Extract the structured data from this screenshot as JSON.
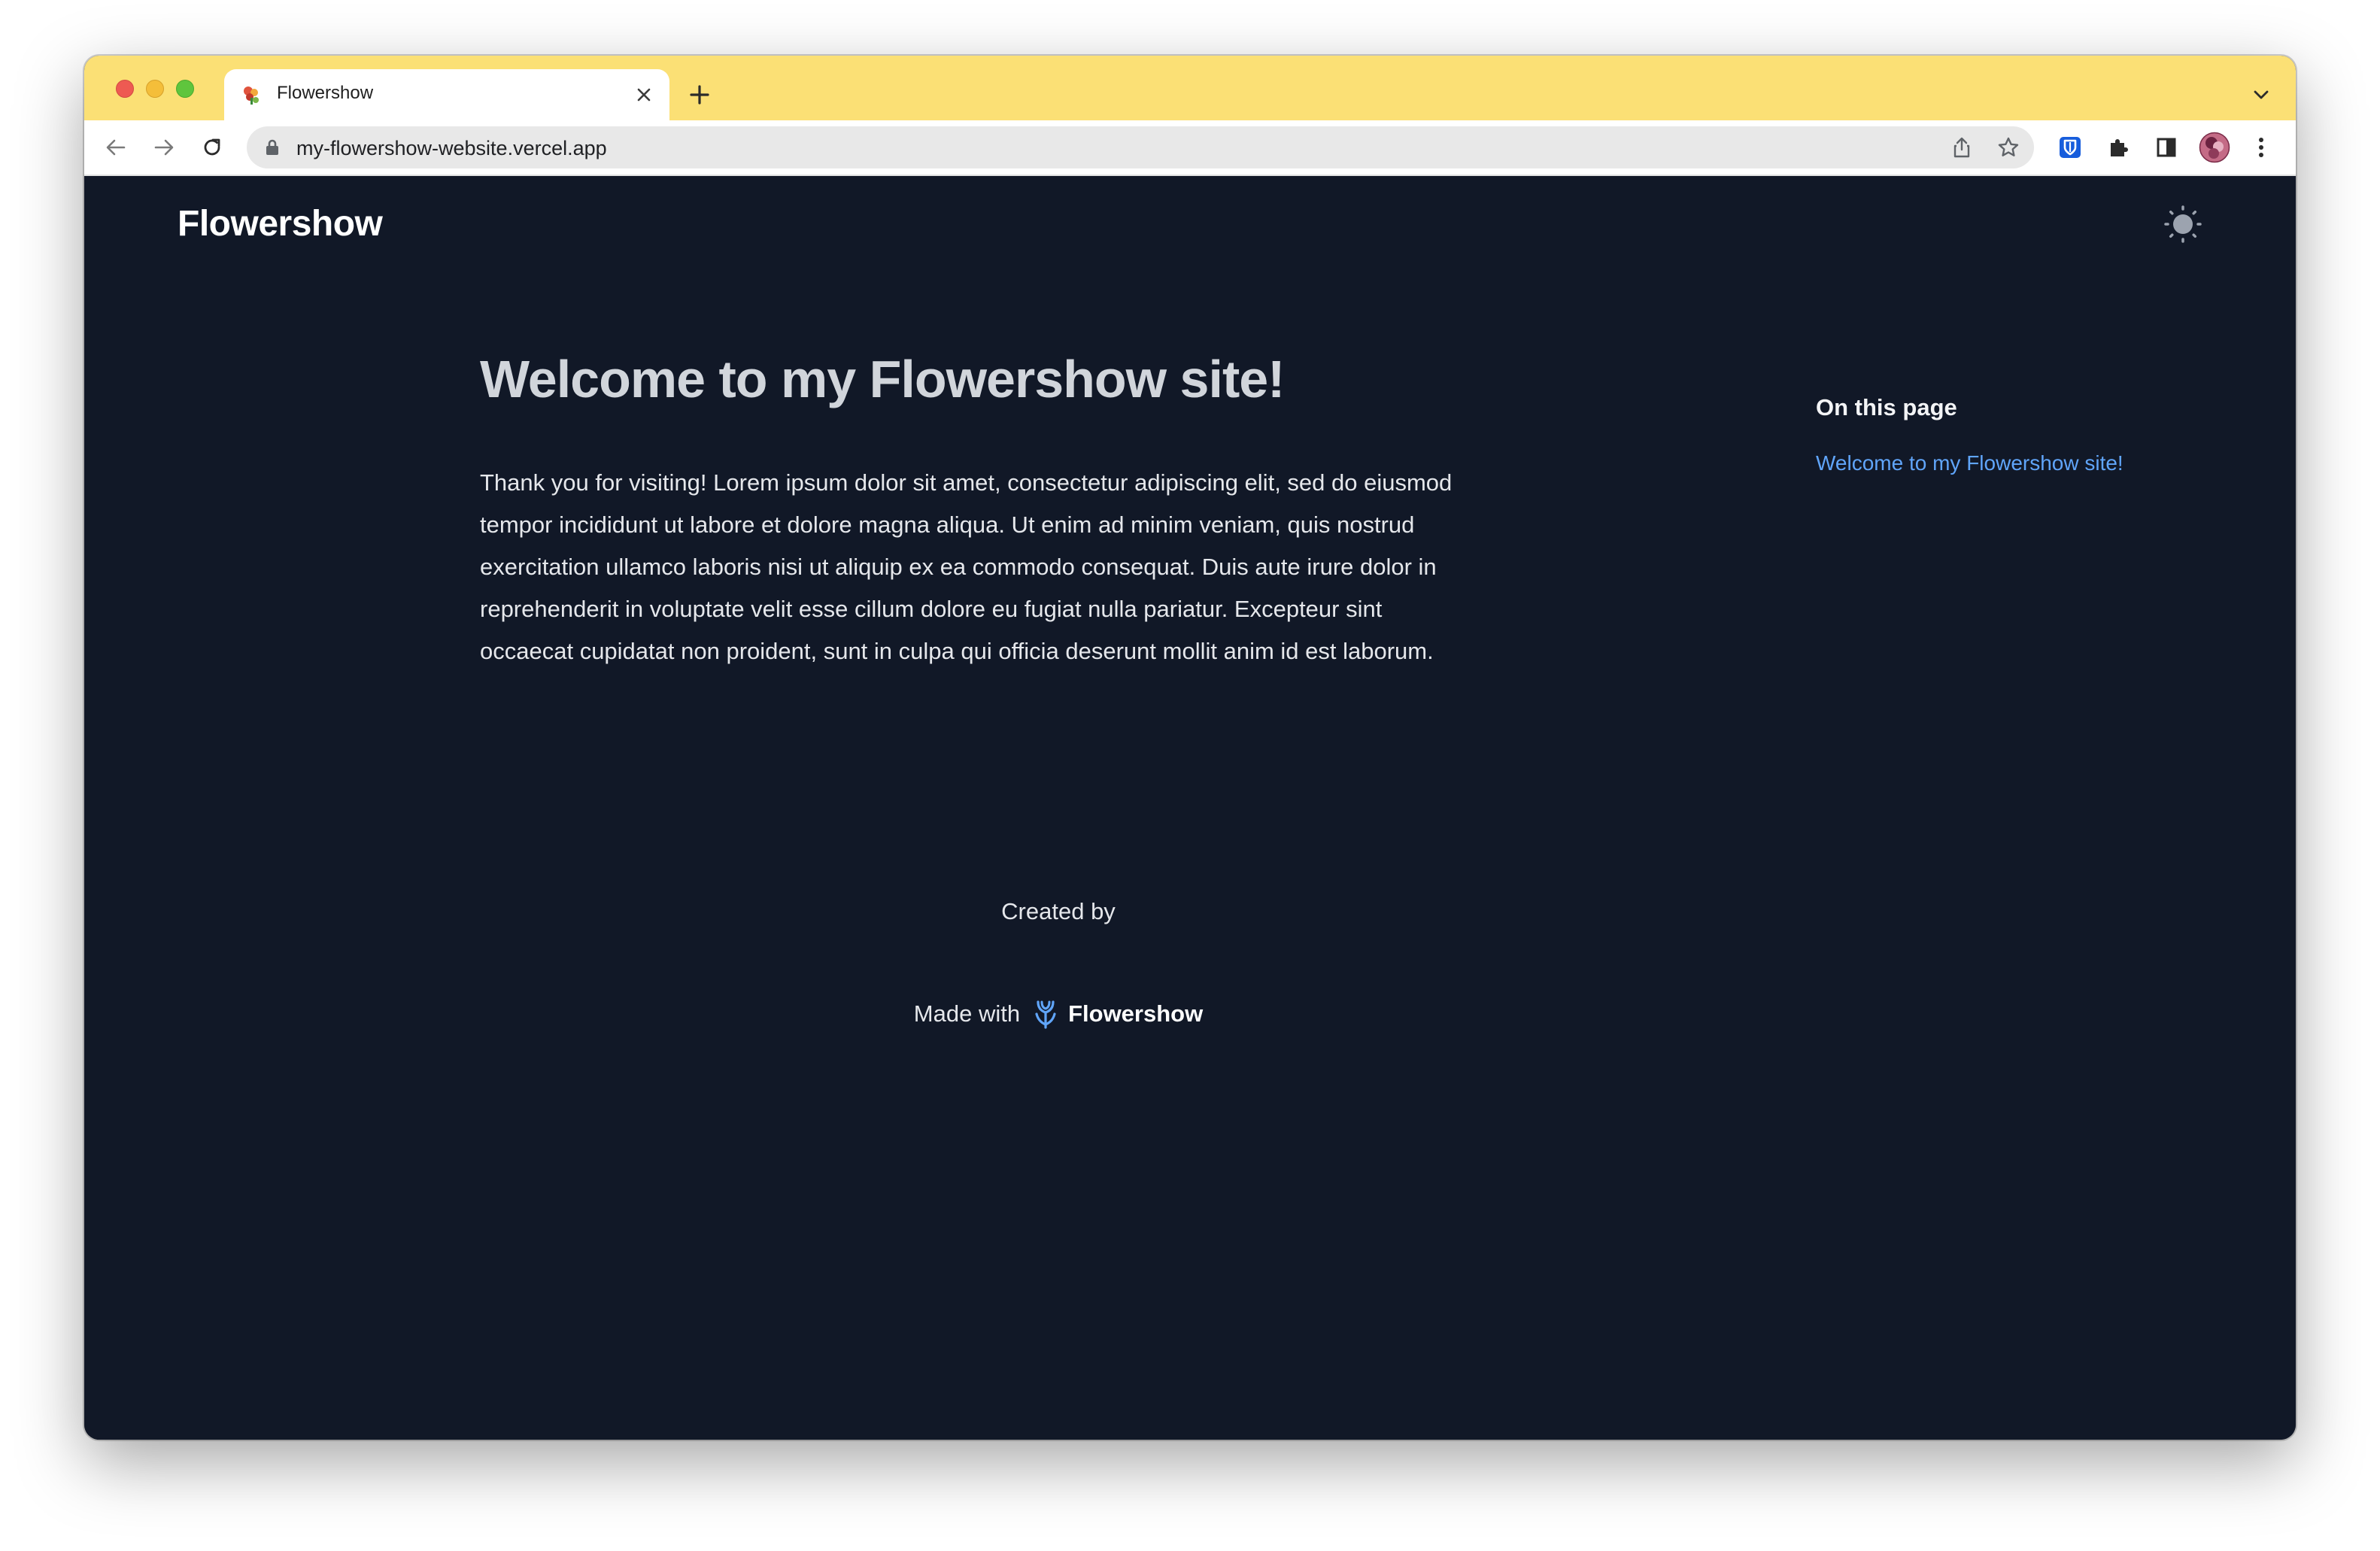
{
  "browser": {
    "tab": {
      "title": "Flowershow"
    },
    "address_bar": {
      "url": "my-flowershow-website.vercel.app"
    }
  },
  "site": {
    "logo": "Flowershow"
  },
  "article": {
    "title": "Welcome to my Flowershow site!",
    "body": "Thank you for visiting! Lorem ipsum dolor sit amet, consectetur adipiscing elit, sed do eiusmod tempor incididunt ut labore et dolore magna aliqua. Ut enim ad minim veniam, quis nostrud exercitation ullamco laboris nisi ut aliquip ex ea commodo consequat. Duis aute irure dolor in reprehenderit in voluptate velit esse cillum dolore eu fugiat nulla pariatur. Excepteur sint occaecat cupidatat non proident, sunt in culpa qui officia deserunt mollit anim id est laborum."
  },
  "toc": {
    "heading": "On this page",
    "items": [
      {
        "label": "Welcome to my Flowershow site!"
      }
    ]
  },
  "footer": {
    "created_by": "Created by",
    "made_with": "Made with",
    "brand": "Flowershow"
  },
  "colors": {
    "tabstrip": "#fbe075",
    "page_background": "#111827",
    "link": "#60a5fa",
    "title": "#d1d5db"
  },
  "icons": {
    "theme_toggle": "sun-icon",
    "brand": "flowershow-logo-icon"
  }
}
